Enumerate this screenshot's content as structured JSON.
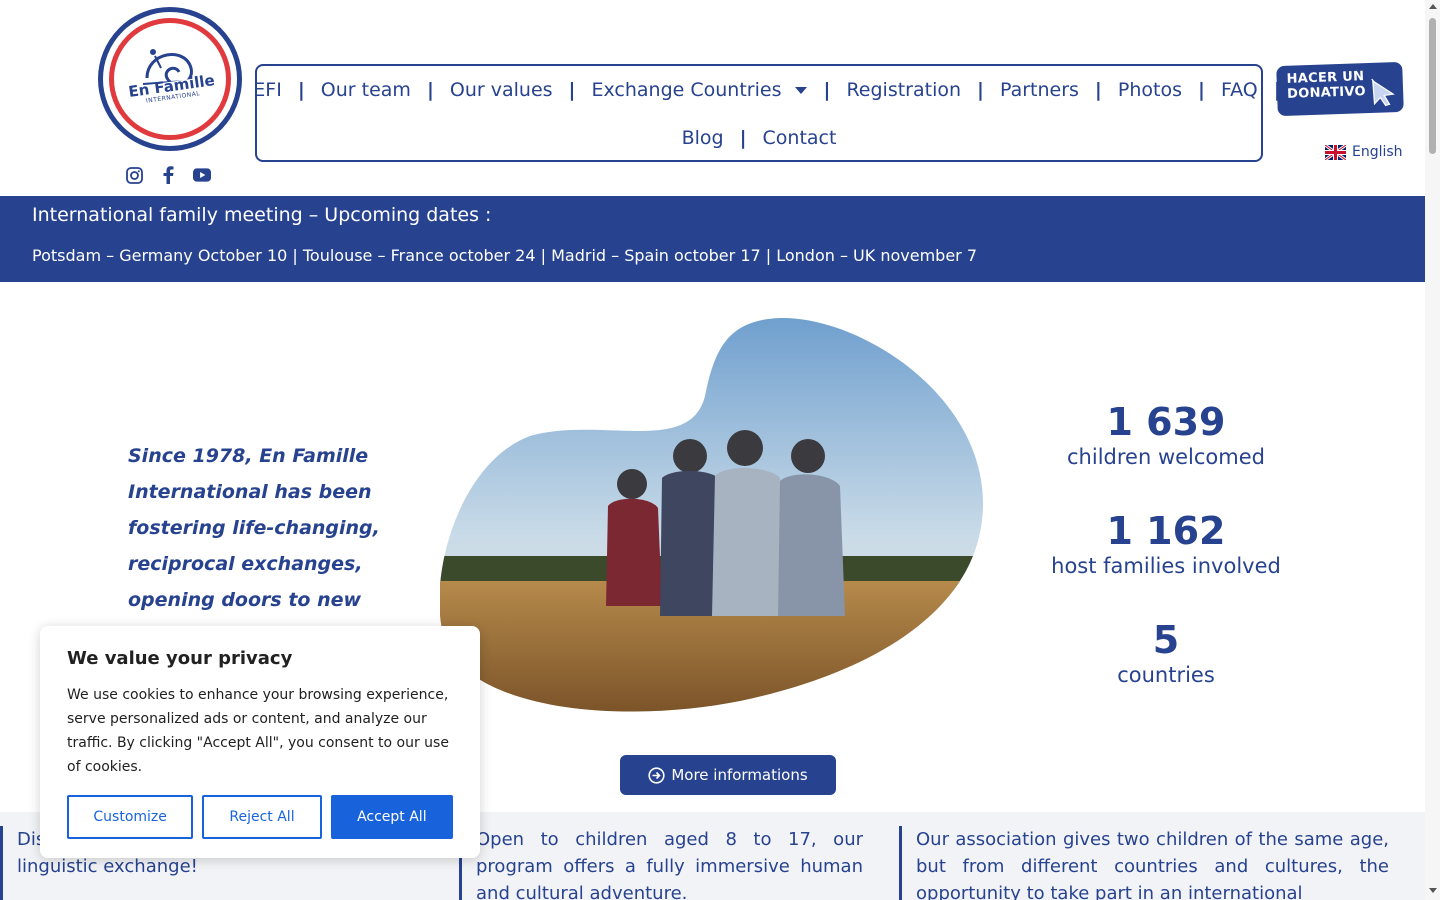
{
  "logo": {
    "text_line1": "En Famille",
    "text_line2": "INTERNATIONAL"
  },
  "socials": [
    "instagram-icon",
    "facebook-icon",
    "youtube-icon"
  ],
  "nav": {
    "row1": [
      {
        "label": "EFI"
      },
      {
        "label": "Our team"
      },
      {
        "label": "Our values"
      },
      {
        "label": "Exchange Countries"
      },
      {
        "label": "Registration"
      },
      {
        "label": "Partners"
      },
      {
        "label": "Photos"
      },
      {
        "label": "FAQ"
      }
    ],
    "row2": [
      {
        "label": "Blog"
      },
      {
        "label": "Contact"
      }
    ],
    "separator": "|"
  },
  "donate": {
    "line1": "HACER UN",
    "line2": "DONATIVO"
  },
  "language": {
    "label": "English"
  },
  "banner": {
    "title": "International family meeting – Upcoming dates :",
    "dates": "Potsdam – Germany October 10 | Toulouse – France october 24 | Madrid – Spain october 17 | London – UK november 7"
  },
  "intro": "Since 1978, En Famille International has been fostering life-changing, reciprocal exchanges, opening doors to new",
  "stats": [
    {
      "number": "1 639",
      "label": "children welcomed"
    },
    {
      "number": "1 162",
      "label": "host families involved"
    },
    {
      "number": "5",
      "label": "countries"
    }
  ],
  "more_button": "More informations",
  "columns": [
    "Discover an international, cultural, and linguistic exchange!",
    "Open to children aged 8 to 17, our program offers a fully immersive human and cultural adventure.",
    "Our association gives two children of the same age, but from different countries and cultures, the opportunity to take part in an international"
  ],
  "cookie": {
    "title": "We value your privacy",
    "text": "We use cookies to enhance your browsing experience, serve personalized ads or content, and analyze our traffic. By clicking \"Accept All\", you consent to our use of cookies.",
    "customize": "Customize",
    "reject": "Reject All",
    "accept": "Accept All"
  },
  "colors": {
    "brand_blue": "#27428f",
    "brand_red": "#e03a3e",
    "cookie_blue": "#1863dc"
  }
}
